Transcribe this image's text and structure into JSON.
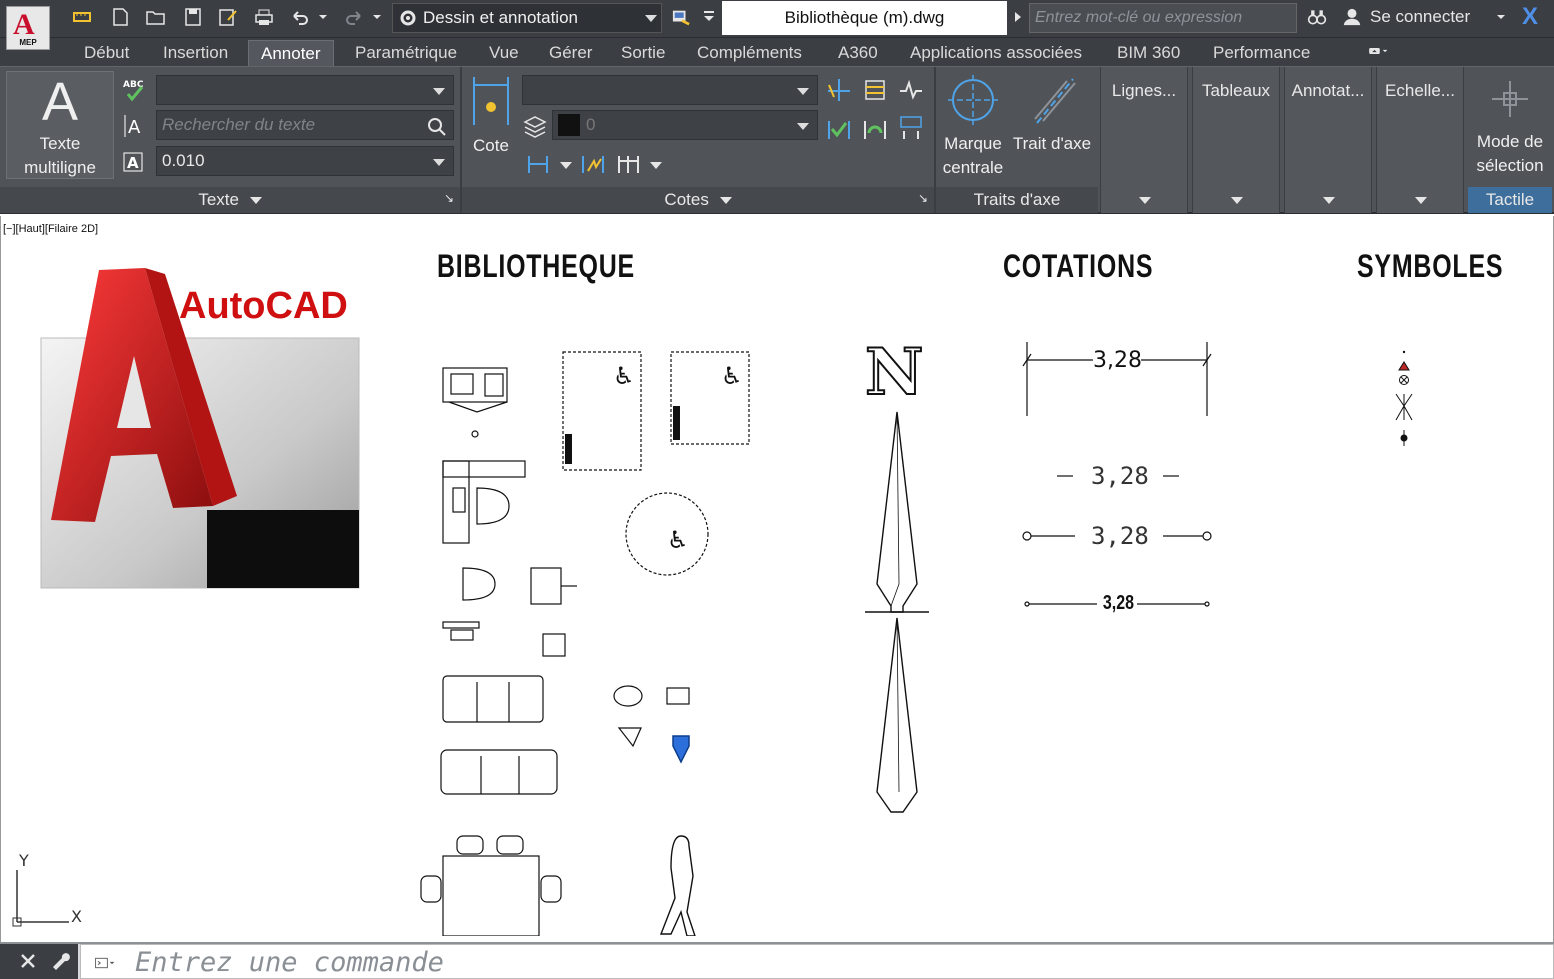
{
  "app": {
    "logo_letter": "A",
    "logo_sub": "MEP",
    "workspace": "Dessin et annotation",
    "document_title": "Bibliothèque (m).dwg",
    "search_placeholder": "Entrez mot-clé ou expression",
    "sign_in": "Se connecter"
  },
  "tabs": [
    {
      "label": "Début"
    },
    {
      "label": "Insertion"
    },
    {
      "label": "Annoter",
      "active": true
    },
    {
      "label": "Paramétrique"
    },
    {
      "label": "Vue"
    },
    {
      "label": "Gérer"
    },
    {
      "label": "Sortie"
    },
    {
      "label": "Compléments"
    },
    {
      "label": "A360"
    },
    {
      "label": "Applications associées"
    },
    {
      "label": "BIM 360"
    },
    {
      "label": "Performance"
    }
  ],
  "ribbon": {
    "texte": {
      "big_line1": "Texte",
      "big_line2": "multiligne",
      "search_placeholder": "Rechercher du texte",
      "height_value": "0.010",
      "title": "Texte"
    },
    "cotes": {
      "cote_label": "Cote",
      "layer_value": "0",
      "title": "Cotes"
    },
    "traits": {
      "marque_line1": "Marque",
      "marque_line2": "centrale",
      "trait_label": "Trait d'axe",
      "title": "Traits d'axe"
    },
    "collapsed": [
      "Lignes...",
      "Tableaux",
      "Annotat...",
      "Echelle..."
    ],
    "tactile": {
      "line1": "Mode de",
      "line2": "sélection",
      "title": "Tactile"
    }
  },
  "canvas": {
    "view_label": "[−][Haut][Filaire 2D]",
    "headings": {
      "bibliotheque": "BIBLIOTHEQUE",
      "cotations": "COTATIONS",
      "symboles": "SYMBOLES"
    },
    "autocad_logo_text": "AutoCAD",
    "north_label": "N",
    "dimensions": [
      "3,28",
      "3,28",
      "3,28",
      "3,28"
    ],
    "ucs": {
      "y": "Y",
      "x": "X"
    }
  },
  "command": {
    "placeholder": "Entrez une commande"
  },
  "colors": {
    "chrome": "#3b3f44",
    "ribbon": "#505458",
    "accent_red": "#c8102e",
    "accent_blue": "#4f8fe8"
  }
}
